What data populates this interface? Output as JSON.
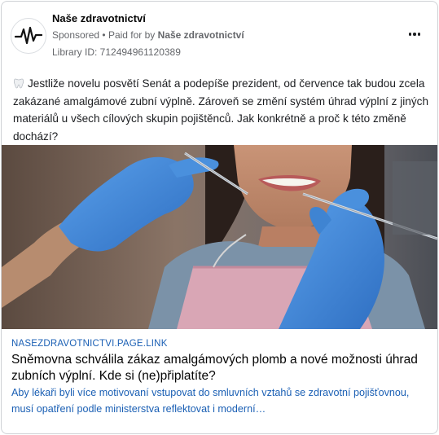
{
  "ad": {
    "page_name": "Naše zdravotnictví",
    "sponsored_label": "Sponsored",
    "separator": "•",
    "paid_for_by_label": "Paid for by",
    "paid_for_by_name": "Naše zdravotnictví",
    "library_id": "Library ID: 712494961120389",
    "body_text": "Jestliže novelu posvětí Senát a podepíše prezident, od července tak budou zcela zakázané amalgámové zubní výplně. Zároveň se změní systém úhrad výplní z jiných materiálů u všech cílových skupin pojištěnců. Jak konkrétně a proč k této změně dochází?",
    "link": {
      "domain": "NASEZDRAVOTNICTVI.PAGE.LINK",
      "headline": "Sněmovna schválila zákaz amalgámových plomb a nové možnosti úhrad zubních výplní. Kde si (ne)připlatíte?",
      "description": "Aby lékaři byli více motivovaní vstupovat do smluvních vztahů se zdravotní pojišťovnou, musí opatření podle ministerstva reflektovat i moderní…"
    },
    "icons": {
      "avatar": "heartbeat-logo-icon",
      "more": "more-options-icon",
      "emoji": "tooth-icon"
    },
    "colors": {
      "link_blue": "#1a5fb4",
      "meta_gray": "#65676b",
      "glove_blue": "#3d86d6"
    }
  }
}
